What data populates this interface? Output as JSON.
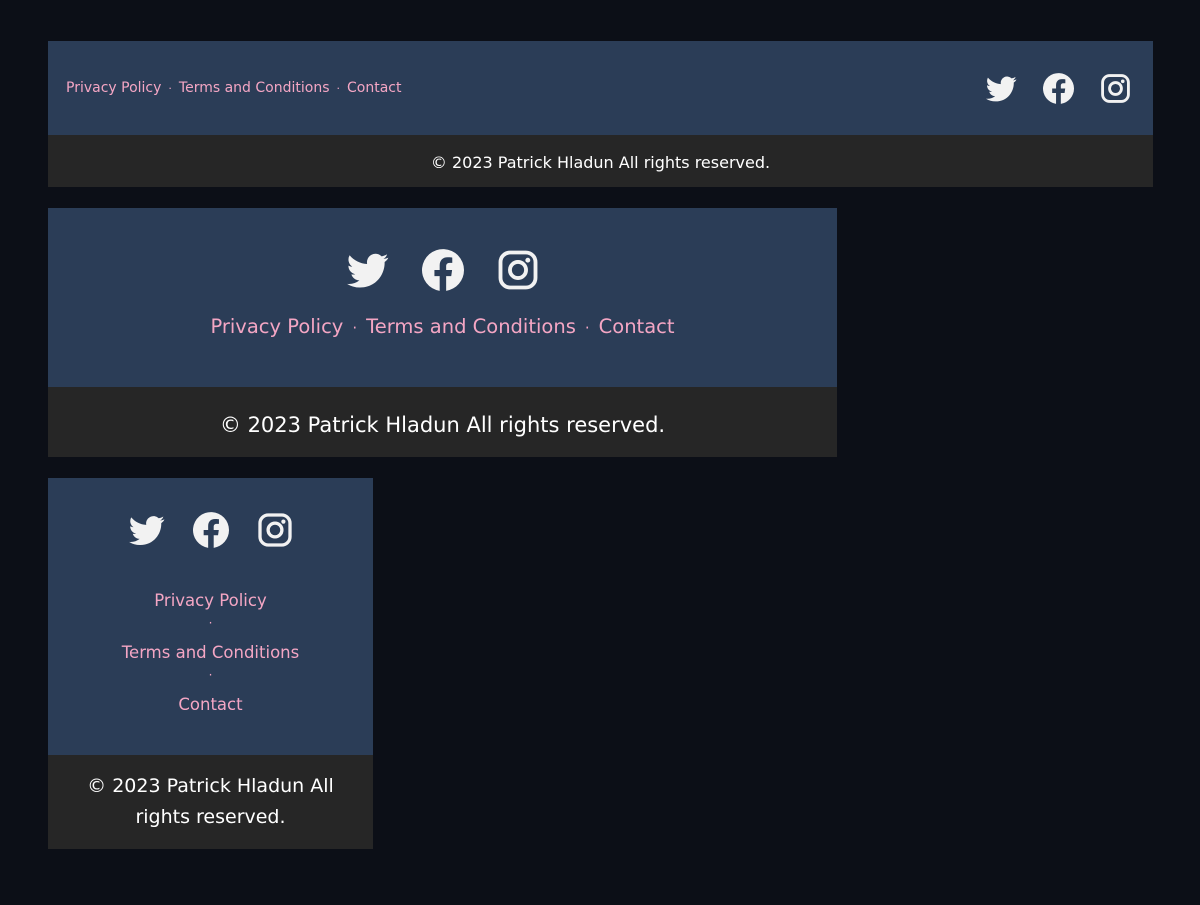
{
  "colors": {
    "page_background": "#0c0f17",
    "footer_top_background": "#2b3d57",
    "footer_bottom_background": "#262626",
    "link_color": "#f4a6c4",
    "icon_color": "#f2f2f2",
    "copyright_color": "#ffffff"
  },
  "footers": [
    {
      "variant": "desktop",
      "links": [
        {
          "label": "Privacy Policy"
        },
        {
          "label": "Terms and Conditions"
        },
        {
          "label": "Contact"
        }
      ],
      "separator": "·",
      "social": [
        {
          "icon": "twitter-icon"
        },
        {
          "icon": "facebook-icon"
        },
        {
          "icon": "instagram-icon"
        }
      ],
      "copyright": "© 2023 Patrick Hladun All rights reserved."
    },
    {
      "variant": "tablet",
      "links": [
        {
          "label": "Privacy Policy"
        },
        {
          "label": "Terms and Conditions"
        },
        {
          "label": "Contact"
        }
      ],
      "separator": "·",
      "social": [
        {
          "icon": "twitter-icon"
        },
        {
          "icon": "facebook-icon"
        },
        {
          "icon": "instagram-icon"
        }
      ],
      "copyright": "© 2023 Patrick Hladun All rights reserved."
    },
    {
      "variant": "mobile",
      "links": [
        {
          "label": "Privacy Policy"
        },
        {
          "label": "Terms and Conditions"
        },
        {
          "label": "Contact"
        }
      ],
      "separator": "·",
      "social": [
        {
          "icon": "twitter-icon"
        },
        {
          "icon": "facebook-icon"
        },
        {
          "icon": "instagram-icon"
        }
      ],
      "copyright": "© 2023 Patrick Hladun All rights reserved."
    }
  ]
}
